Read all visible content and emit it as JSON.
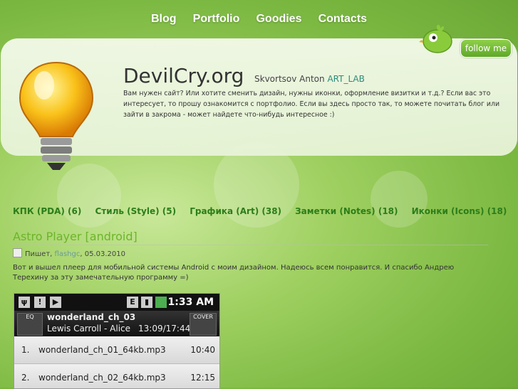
{
  "nav": [
    "Blog",
    "Portfolio",
    "Goodies",
    "Contacts"
  ],
  "follow_label": "follow me",
  "site": {
    "title": "DevilCry.org",
    "author": "Skvortsov Anton",
    "lab": "ART_LAB",
    "intro": "Вам нужен сайт? Или хотите сменить дизайн, нужны иконки, оформление визитки и т.д.? Если вас это интересует, то прошу ознакомится с портфолио. Если вы здесь просто так, то можете почитать блог или зайти в закрома - может найдете что-нибудь интересное :)"
  },
  "categories": [
    "КПК (PDA) (6)",
    "Стиль (Style) (5)",
    "Графика (Art) (38)",
    "Заметки (Notes) (18)",
    "Иконки (Icons) (18)"
  ],
  "post": {
    "title": "Astro Player [android]",
    "meta_prefix": "Пишет,",
    "meta_author": "flashgc",
    "meta_date": ", 05.03.2010",
    "body": "Вот и вышел плеер для мобильной системы Android с моим дизайном. Надеюсь всем понравится. И спасибо Андрею Терехину за эту замечательную программу =)"
  },
  "phone": {
    "time": "1:33 AM",
    "eq": "EQ",
    "cover": "COVER",
    "now_title": "wonderland_ch_03",
    "now_artist": "Lewis Carroll - Alice",
    "now_time": "13:09/17:44",
    "tracks": [
      {
        "n": "1.",
        "name": "wonderland_ch_01_64kb.mp3",
        "dur": "10:40"
      },
      {
        "n": "2.",
        "name": "wonderland_ch_02_64kb.mp3",
        "dur": "12:15"
      }
    ]
  },
  "colors": {
    "accent": "#6db42b",
    "category": "#2c7d1a",
    "follow": "#6fbc36"
  }
}
